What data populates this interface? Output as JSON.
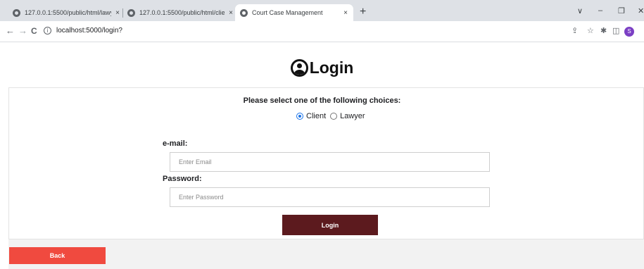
{
  "browser": {
    "tabs": [
      {
        "title": "127.0.0.1:5500/public/html/lawy",
        "close": "×"
      },
      {
        "title": "127.0.0.1:5500/public/html/clien",
        "close": "×"
      },
      {
        "title": "Court Case Management",
        "close": "×"
      }
    ],
    "new_tab": "+",
    "window": {
      "dropdown": "∨",
      "minimize": "–",
      "maximize": "❐",
      "close": "✕"
    },
    "nav": {
      "back": "←",
      "forward": "→",
      "reload": "C"
    },
    "info": "i",
    "url": "localhost:5000/login?",
    "toolbar_icons": {
      "share": "⇪",
      "bookmark": "☆",
      "extensions": "✱",
      "sidepanel": "◫"
    },
    "profile_initial": "S"
  },
  "page": {
    "title": "Login",
    "prompt": "Please select one of the following choices:",
    "choices": [
      {
        "label": "Client",
        "checked": true
      },
      {
        "label": "Lawyer",
        "checked": false
      }
    ],
    "email": {
      "label": "e-mail:",
      "placeholder": "Enter Email",
      "value": ""
    },
    "password": {
      "label": "Password:",
      "placeholder": "Enter Password",
      "value": ""
    },
    "login_label": "Login",
    "back_label": "Back"
  },
  "colors": {
    "login_button": "#5c1a1e",
    "back_button": "#f04a3f",
    "radio_selected": "#1a73e8",
    "profile": "#7b3fc4"
  }
}
